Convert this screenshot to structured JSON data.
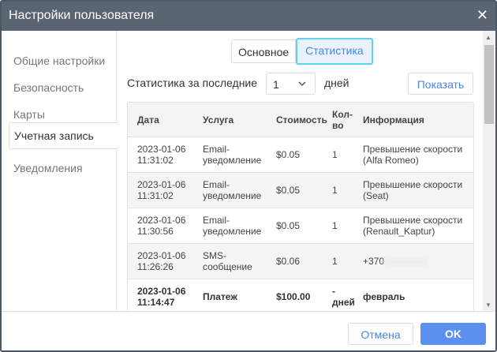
{
  "title": "Настройки пользователя",
  "sidebar": {
    "items": [
      {
        "label": "Общие настройки"
      },
      {
        "label": "Безопасность"
      },
      {
        "label": "Карты"
      },
      {
        "label": "Учетная запись"
      },
      {
        "label": "Уведомления"
      }
    ]
  },
  "tabs": [
    {
      "label": "Основное"
    },
    {
      "label": "Статистика"
    }
  ],
  "filter": {
    "prefix": "Статистика за последние",
    "value": "1",
    "suffix": "дней",
    "show_button": "Показать"
  },
  "table": {
    "headers": [
      "Дата",
      "Услуга",
      "Стоимость",
      "Кол-во",
      "Информация"
    ],
    "rows": [
      {
        "date": "2023-01-06 11:31:02",
        "service": "Email-уведомление",
        "cost": "$0.05",
        "qty": "1",
        "info": "Превышение скорости (Alfa Romeo)"
      },
      {
        "date": "2023-01-06 11:31:02",
        "service": "Email-уведомление",
        "cost": "$0.05",
        "qty": "1",
        "info": "Превышение скорости (Seat)"
      },
      {
        "date": "2023-01-06 11:30:56",
        "service": "Email-уведомление",
        "cost": "$0.05",
        "qty": "1",
        "info": "Превышение скорости (Renault_Kaptur)"
      },
      {
        "date": "2023-01-06 11:26:26",
        "service": "SMS-сообщение",
        "cost": "$0.06",
        "qty": "1",
        "info": "+370"
      },
      {
        "date": "2023-01-06 11:14:47",
        "service": "Платеж",
        "cost": "$100.00",
        "qty": "- дней",
        "info": "февраль"
      }
    ]
  },
  "footer": {
    "cancel": "Отмена",
    "ok": "OK"
  }
}
